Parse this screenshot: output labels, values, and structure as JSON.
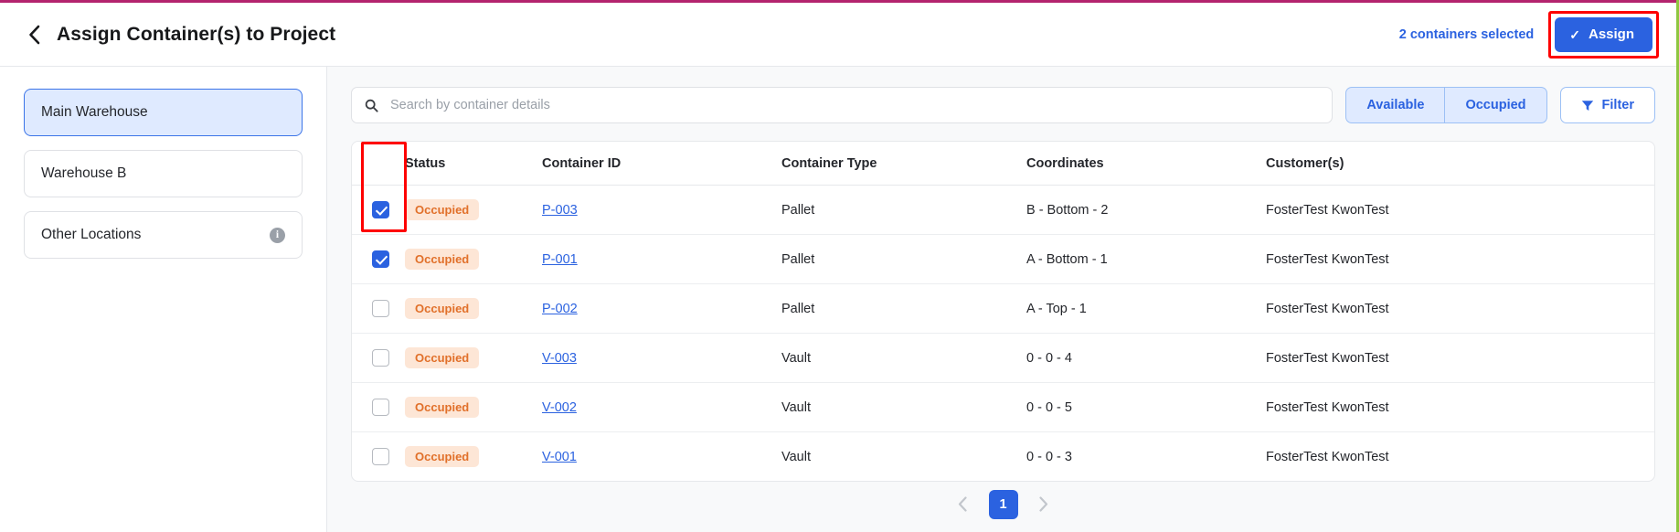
{
  "theme": {
    "accent_blue": "#2b62e0",
    "accent_light_blue": "#dfeaff",
    "badge_bg": "#fde6d6",
    "badge_text": "#e1702a",
    "annotation_red": "#fe0000",
    "top_rule": "#b4246e"
  },
  "header": {
    "back_icon": "chevron-left-icon",
    "title": "Assign Container(s) to Project",
    "selection_text": "2 containers selected",
    "assign_label": "Assign",
    "assign_icon": "check-icon"
  },
  "sidebar": {
    "items": [
      {
        "label": "Main Warehouse",
        "active": true,
        "info": false
      },
      {
        "label": "Warehouse B",
        "active": false,
        "info": false
      },
      {
        "label": "Other Locations",
        "active": false,
        "info": true,
        "info_icon": "info-icon"
      }
    ]
  },
  "toolbar": {
    "search": {
      "icon": "search-icon",
      "value": "",
      "placeholder": "Search by container details"
    },
    "segmented": [
      {
        "label": "Available",
        "selected": false
      },
      {
        "label": "Occupied",
        "selected": true
      }
    ],
    "filter": {
      "label": "Filter",
      "icon": "filter-icon"
    }
  },
  "table": {
    "columns": [
      "",
      "Status",
      "Container ID",
      "Container Type",
      "Coordinates",
      "Customer(s)"
    ],
    "rows": [
      {
        "checked": true,
        "status": "Occupied",
        "id": "P-003",
        "type": "Pallet",
        "coordinates": "B - Bottom - 2",
        "customer": "FosterTest KwonTest"
      },
      {
        "checked": true,
        "status": "Occupied",
        "id": "P-001",
        "type": "Pallet",
        "coordinates": "A - Bottom - 1",
        "customer": "FosterTest KwonTest"
      },
      {
        "checked": false,
        "status": "Occupied",
        "id": "P-002",
        "type": "Pallet",
        "coordinates": "A - Top - 1",
        "customer": "FosterTest KwonTest"
      },
      {
        "checked": false,
        "status": "Occupied",
        "id": "V-003",
        "type": "Vault",
        "coordinates": "0 - 0 - 4",
        "customer": "FosterTest KwonTest"
      },
      {
        "checked": false,
        "status": "Occupied",
        "id": "V-002",
        "type": "Vault",
        "coordinates": "0 - 0 - 5",
        "customer": "FosterTest KwonTest"
      },
      {
        "checked": false,
        "status": "Occupied",
        "id": "V-001",
        "type": "Vault",
        "coordinates": "0 - 0 - 3",
        "customer": "FosterTest KwonTest"
      }
    ]
  },
  "pagination": {
    "prev_icon": "chevron-left-icon",
    "next_icon": "chevron-right-icon",
    "pages": [
      "1"
    ],
    "current": "1"
  }
}
